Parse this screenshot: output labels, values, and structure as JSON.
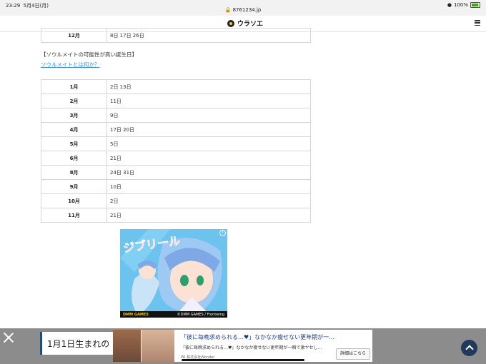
{
  "status_bar": {
    "time": "23:29",
    "date": "5月4日(月)",
    "url": "8761234.jp",
    "battery": "100%"
  },
  "header": {
    "site_name": "ウラソエ"
  },
  "table_top": [
    {
      "month": "12月",
      "days": "8日 17日 26日"
    }
  ],
  "section": {
    "heading": "【ソウルメイトの可能性が高い誕生日】",
    "link": "ソウルメイトとは何か？"
  },
  "table_main": [
    {
      "month": "1月",
      "days": "2日 13日"
    },
    {
      "month": "2月",
      "days": "11日"
    },
    {
      "month": "3月",
      "days": "9日"
    },
    {
      "month": "4月",
      "days": "17日 20日"
    },
    {
      "month": "5月",
      "days": "5日"
    },
    {
      "month": "6月",
      "days": "21日"
    },
    {
      "month": "8月",
      "days": "24日 31日"
    },
    {
      "month": "9月",
      "days": "10日"
    },
    {
      "month": "10月",
      "days": "2日"
    },
    {
      "month": "11月",
      "days": "21日"
    }
  ],
  "ad": {
    "logo_text": "ジブリール",
    "info_label": "i",
    "brand": "DMM GAMES",
    "credit": "©DMM GAMES / Frontwing"
  },
  "promo": {
    "text": "1月1日生まれの"
  },
  "banner": {
    "title": "「彼に毎晩求められる…♥」なかなか瘦せない更年期が一…",
    "subtitle": "『彼に毎晩求められる…♥』なかなか瘦せない更年期が一瞬で激ヤセし…",
    "pr": "PR 株式会社Wonder",
    "button": "詳細はこちら"
  }
}
